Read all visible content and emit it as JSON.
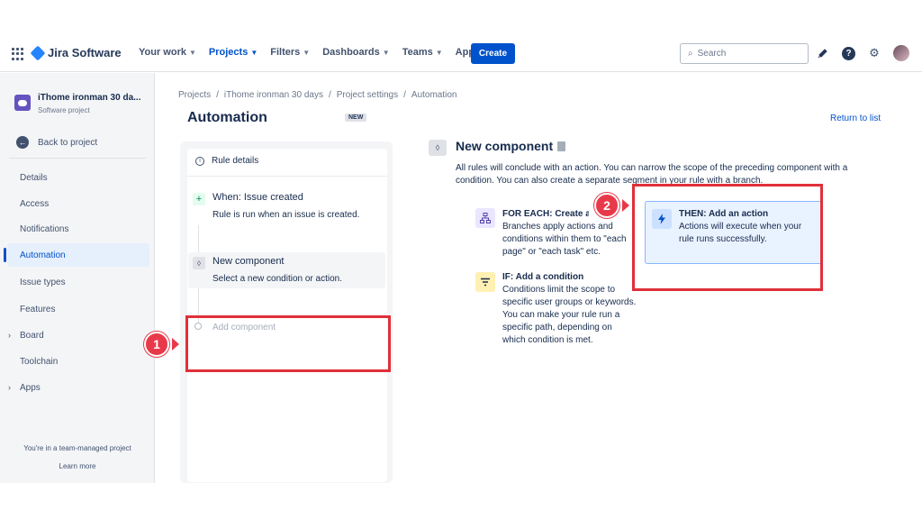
{
  "topnav": {
    "product": "Jira Software",
    "items": [
      {
        "label": "Your work",
        "active": false
      },
      {
        "label": "Projects",
        "active": true
      },
      {
        "label": "Filters",
        "active": false
      },
      {
        "label": "Dashboards",
        "active": false
      },
      {
        "label": "Teams",
        "active": false
      },
      {
        "label": "Apps",
        "active": false
      }
    ],
    "create_label": "Create",
    "search_placeholder": "Search"
  },
  "sidebar": {
    "project_name": "iThome ironman 30 da...",
    "project_type": "Software project",
    "back_label": "Back to project",
    "items": [
      {
        "label": "Details"
      },
      {
        "label": "Access"
      },
      {
        "label": "Notifications"
      },
      {
        "label": "Automation",
        "active": true
      },
      {
        "label": "Issue types"
      },
      {
        "label": "Features"
      },
      {
        "label": "Board",
        "expandable": true
      },
      {
        "label": "Toolchain"
      },
      {
        "label": "Apps",
        "expandable": true
      }
    ],
    "team_note": "You're in a team-managed project",
    "learn_more": "Learn more"
  },
  "breadcrumb": [
    "Projects",
    "iThome ironman 30 days",
    "Project settings",
    "Automation"
  ],
  "page": {
    "title": "Automation",
    "badge": "NEW",
    "return_label": "Return to list"
  },
  "rule": {
    "details_label": "Rule details",
    "trigger_title": "When: Issue created",
    "trigger_desc": "Rule is run when an issue is created.",
    "new_component_title": "New component",
    "new_component_desc": "Select a new condition or action.",
    "add_component": "Add component"
  },
  "component_panel": {
    "title": "New component",
    "desc": "All rules will conclude with an action. You can narrow the scope of the preceding component with a condition. You can also create a separate segment in your rule with a branch.",
    "options": {
      "foreach": {
        "title": "FOR EACH: Create a branch",
        "desc": "Branches apply actions and conditions within them to \"each page\" or \"each task\" etc."
      },
      "if": {
        "title": "IF: Add a condition",
        "desc": "Conditions limit the scope to specific user groups or keywords. You can make your rule run a specific path, depending on which condition is met."
      },
      "then": {
        "title": "THEN: Add an action",
        "desc": "Actions will execute when your rule runs successfully."
      }
    }
  },
  "annotations": {
    "step1": "1",
    "step2": "2",
    "color": "#e0303a"
  }
}
